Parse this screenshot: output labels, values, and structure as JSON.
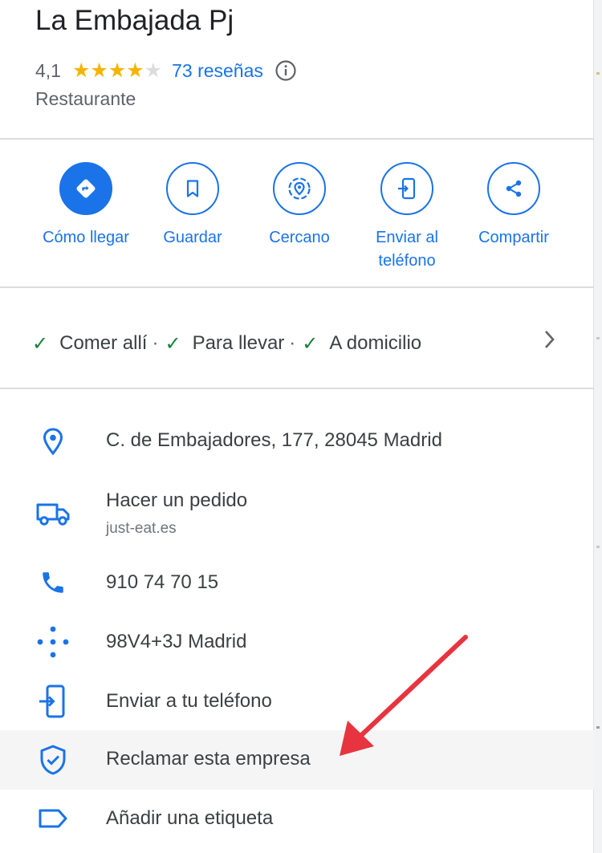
{
  "place": {
    "name": "La Embajada Pj",
    "rating": "4,1",
    "stars_filled": 4,
    "stars_total": 5,
    "reviews": "73 reseñas",
    "category": "Restaurante"
  },
  "actions": [
    {
      "label": "Cómo llegar",
      "icon": "directions-icon"
    },
    {
      "label": "Guardar",
      "icon": "bookmark-icon"
    },
    {
      "label": "Cercano",
      "icon": "nearby-icon"
    },
    {
      "label": "Enviar al teléfono",
      "icon": "send-to-phone-icon"
    },
    {
      "label": "Compartir",
      "icon": "share-icon"
    }
  ],
  "services": [
    "Comer allí",
    "Para llevar",
    "A domicilio"
  ],
  "info": {
    "address": "C. de Embajadores, 177, 28045 Madrid",
    "order_title": "Hacer un pedido",
    "order_site": "just-eat.es",
    "phone": "910 74 70 15",
    "plus_code": "98V4+3J Madrid",
    "send_phone": "Enviar a tu teléfono",
    "claim": "Reclamar esta empresa",
    "add_label": "Añadir una etiqueta"
  },
  "colors": {
    "accent": "#1a73e8",
    "star": "#f4b400",
    "check": "#188038",
    "annotation_arrow": "#e8343e"
  }
}
